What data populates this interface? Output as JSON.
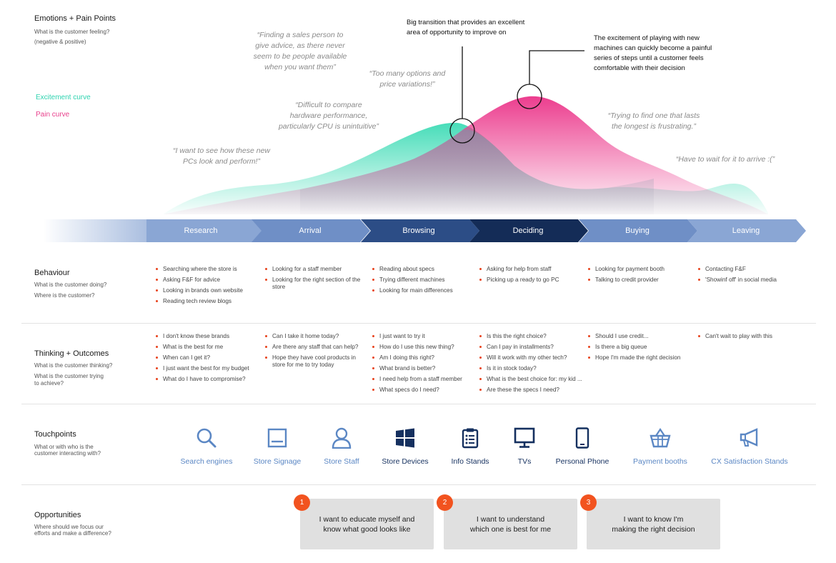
{
  "emotions": {
    "title": "Emotions + Pain Points",
    "subtitle1": "What is the customer feeling?",
    "subtitle2": "(negative & positive)",
    "legend_excitement": "Excitement curve",
    "legend_pain": "Pain curve",
    "excitement_color": "#3ddbb5",
    "pain_color": "#ec3d8e",
    "quotes": [
      "“Finding a sales person to\ngive advice, as there never\nseem to be people available\nwhen you want them”",
      "“Too many options and\nprice variations!”",
      "“Difficult to compare\nhardware performance,\nparticularly CPU is unintuitive”",
      "“I want to see how these new\nPCs look and perform!”",
      "“Trying to find one that lasts\nthe longest is frustrating.”",
      "“Have to wait for it to arrive :(”"
    ],
    "annotation1": "Big transition that provides an excellent\narea of opportunity to improve on",
    "annotation2": "The excitement of playing with new\nmachines can quickly become a painful\nseries of steps until a customer feels\ncomfortable with their decision"
  },
  "stages": [
    "Research",
    "Arrival",
    "Browsing",
    "Deciding",
    "Buying",
    "Leaving"
  ],
  "stage_colors": [
    "#8aa6d4",
    "#6f8fc6",
    "#2c4d86",
    "#142c57",
    "#6f8fc6",
    "#8aa6d4"
  ],
  "behaviour": {
    "title": "Behaviour",
    "sub1": "What is the customer doing?",
    "sub2": "Where is the customer?",
    "columns": [
      [
        "Searching where the store is",
        "Asking F&F for advice",
        "Looking in brands own website",
        "Reading tech review blogs"
      ],
      [
        "Looking for a staff member",
        "Looking for the right section of the store"
      ],
      [
        "Reading about specs",
        "Trying different machines",
        "Looking for main differences"
      ],
      [
        "Asking for help from staff",
        "Picking up a ready to go PC"
      ],
      [
        "Looking for payment booth",
        "Talking to credit provider"
      ],
      [
        "Contacting F&F",
        "'Showinf off' in social media"
      ]
    ]
  },
  "thinking": {
    "title": "Thinking + Outcomes",
    "sub1": "What is the customer thinking?",
    "sub2": "What is the customer trying",
    "sub3": "to achieve?",
    "columns": [
      [
        "I don't know these brands",
        "What is the best for me",
        "When can I get it?",
        "I just want the best for my budget",
        "What do I have to compromise?"
      ],
      [
        "Can I take it home today?",
        "Are there any staff that can help?",
        "Hope they have cool products in store for me to try today"
      ],
      [
        "I just want to try it",
        "How do I use this new thing?",
        "Am I doing this right?",
        "What brand is better?",
        "I need help from a staff member",
        "What specs do I need?"
      ],
      [
        "Is this the right choice?",
        "Can I pay in installments?",
        "Will it work with my other tech?",
        "Is it in stock today?",
        "What is the best choice for: my kid ...",
        "Are these the specs I need?"
      ],
      [
        "Should I use credit...",
        "Is there a big queue",
        "Hope I'm made the right decision"
      ],
      [
        "Can't wait to play with this"
      ]
    ]
  },
  "touchpoints": {
    "title": "Touchpoints",
    "sub1": "What or with who is the",
    "sub2": "customer interacting with?",
    "items": [
      {
        "label": "Search engines",
        "icon": "search-icon",
        "color": "#5b87c4"
      },
      {
        "label": "Store Signage",
        "icon": "signage-icon",
        "color": "#5b87c4"
      },
      {
        "label": "Store Staff",
        "icon": "person-icon",
        "color": "#5b87c4"
      },
      {
        "label": "Store Devices",
        "icon": "windows-icon",
        "color": "#15305f"
      },
      {
        "label": "Info Stands",
        "icon": "clipboard-icon",
        "color": "#15305f"
      },
      {
        "label": "TVs",
        "icon": "monitor-icon",
        "color": "#15305f"
      },
      {
        "label": "Personal Phone",
        "icon": "phone-icon",
        "color": "#15305f"
      },
      {
        "label": "Payment booths",
        "icon": "basket-icon",
        "color": "#5b87c4"
      },
      {
        "label": "CX Satisfaction Stands",
        "icon": "megaphone-icon",
        "color": "#5b87c4"
      }
    ]
  },
  "opportunities": {
    "title": "Opportunities",
    "sub1": "Where should we focus our",
    "sub2": "efforts and make a difference?",
    "items": [
      {
        "num": "1",
        "text": "I want to educate myself and\nknow what good looks like"
      },
      {
        "num": "2",
        "text": "I want to understand\nwhich one is best for me"
      },
      {
        "num": "3",
        "text": "I want to know I'm\nmaking the right decision"
      }
    ],
    "badge_color": "#f2531f"
  }
}
